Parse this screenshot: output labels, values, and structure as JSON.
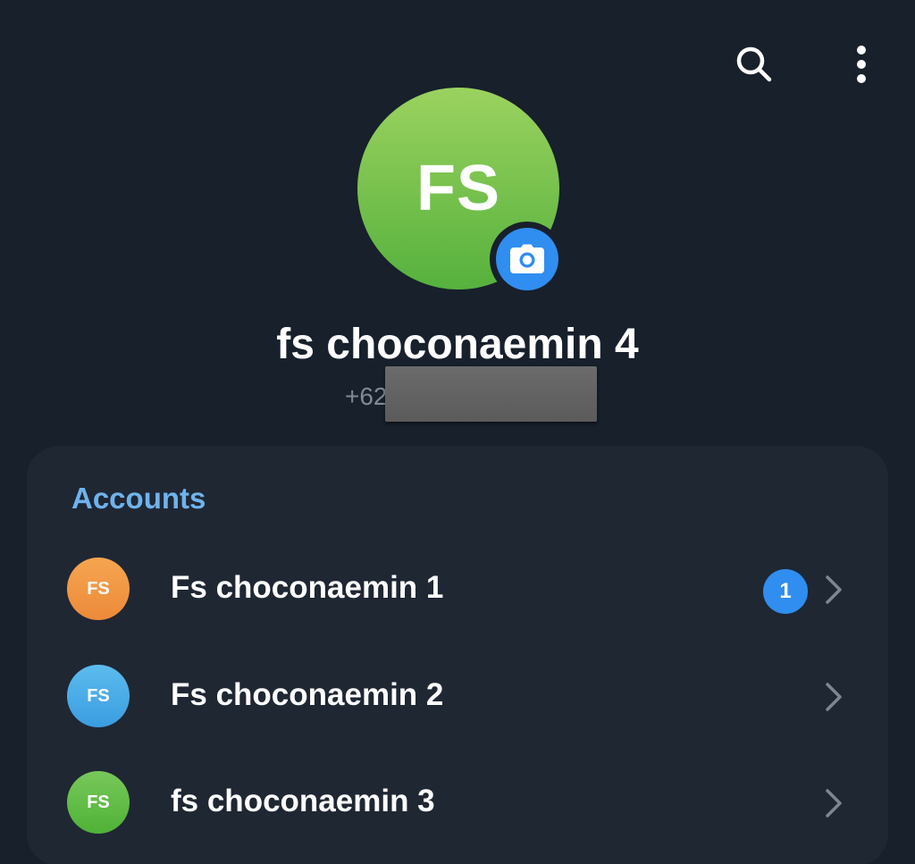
{
  "toolbar": {
    "search_icon": "search-icon",
    "more_icon": "more-vertical-icon"
  },
  "profile": {
    "initials": "FS",
    "name": "fs choconaemin 4",
    "phone_prefix": "+62",
    "avatar_colors": [
      "#9bd25f",
      "#56b13d"
    ],
    "camera_icon": "camera-icon",
    "camera_color": "#2f8ef0"
  },
  "accounts": {
    "heading": "Accounts",
    "heading_color": "#6fb3ec",
    "items": [
      {
        "initials": "FS",
        "name": "Fs choconaemin 1",
        "avatar_color": "#ef8f3c",
        "unread": "1"
      },
      {
        "initials": "FS",
        "name": "Fs choconaemin 2",
        "avatar_color": "#3ea7e6",
        "unread": null
      },
      {
        "initials": "FS",
        "name": "fs choconaemin 3",
        "avatar_color": "#55b83b",
        "unread": null
      }
    ]
  }
}
